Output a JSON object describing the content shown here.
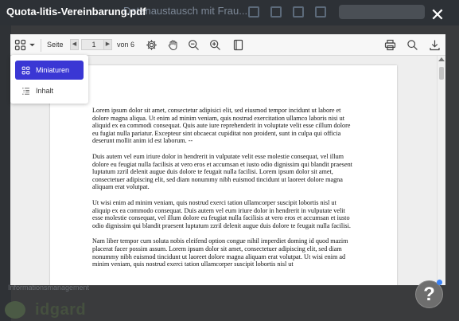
{
  "background": {
    "tab_title": "Datenaustausch mit Frau...",
    "footer_label": "Informationsmanagement",
    "logo_text": "idgard"
  },
  "modal": {
    "file_title": "Quota-litis-Vereinbarung.pdf",
    "close_symbol": "✕"
  },
  "toolbar": {
    "page_label": "Seite",
    "current_page": "1",
    "of_pages": "von 6",
    "prev_symbol": "◀",
    "next_symbol": "▶",
    "icons": [
      "thumbnails-icon",
      "chevron-down-icon",
      "settings-icon",
      "hand-icon",
      "zoom-out-icon",
      "zoom-in-icon",
      "page-layout-icon",
      "print-icon",
      "search-icon",
      "download-icon"
    ]
  },
  "dropdown": {
    "items": [
      {
        "label": "Miniaturen",
        "icon": "thumbnails-icon",
        "active": true
      },
      {
        "label": "Inhalt",
        "icon": "list-icon",
        "active": false
      }
    ]
  },
  "document": {
    "paragraphs": [
      "Lorem ipsum dolor sit amet, consectetur adipisici elit, sed eiusmod tempor incidunt ut labore et dolore magna aliqua. Ut enim ad minim veniam, quis nostrud exercitation ullamco laboris nisi ut aliquid ex ea commodi consequat. Quis aute iure reprehenderit in voluptate velit esse cillum dolore eu fugiat nulla pariatur. Excepteur sint obcaecat cupiditat non proident, sunt in culpa qui officia deserunt mollit anim id est laborum. --",
      "Duis autem vel eum iriure dolor in hendrerit in vulputate velit esse molestie consequat, vel illum dolore eu feugiat nulla facilisis at vero eros et accumsan et iusto odio dignissim qui blandit praesent luptatum zzril delenit augue duis dolore te feugait nulla facilisi. Lorem ipsum dolor sit amet, consectetuer adipiscing elit, sed diam nonummy nibh euismod tincidunt ut laoreet dolore magna aliquam erat volutpat.",
      "Ut wisi enim ad minim veniam, quis nostrud exerci tation ullamcorper suscipit lobortis nisl ut aliquip ex ea commodo consequat. Duis autem vel eum iriure dolor in hendrerit in vulputate velit esse molestie consequat, vel illum dolore eu feugiat nulla facilisis at vero eros et accumsan et iusto odio dignissim qui blandit praesent luptatum zzril delenit augue duis dolore te feugait nulla facilisi.",
      "Nam liber tempor cum soluta nobis eleifend option congue nihil imperdiet doming id quod mazim placerat facer possim assum. Lorem ipsum dolor sit amet, consectetuer adipiscing elit, sed diam nonummy nibh euismod tincidunt ut laoreet dolore magna aliquam erat volutpat. Ut wisi enim ad minim veniam, quis nostrud exerci tation ullamcorper suscipit lobortis nisl ut"
    ]
  },
  "help": {
    "symbol": "?"
  },
  "colors": {
    "accent": "#3a37d4",
    "overlay": "#3a3b3d",
    "help_dot": "#3b82f6"
  }
}
